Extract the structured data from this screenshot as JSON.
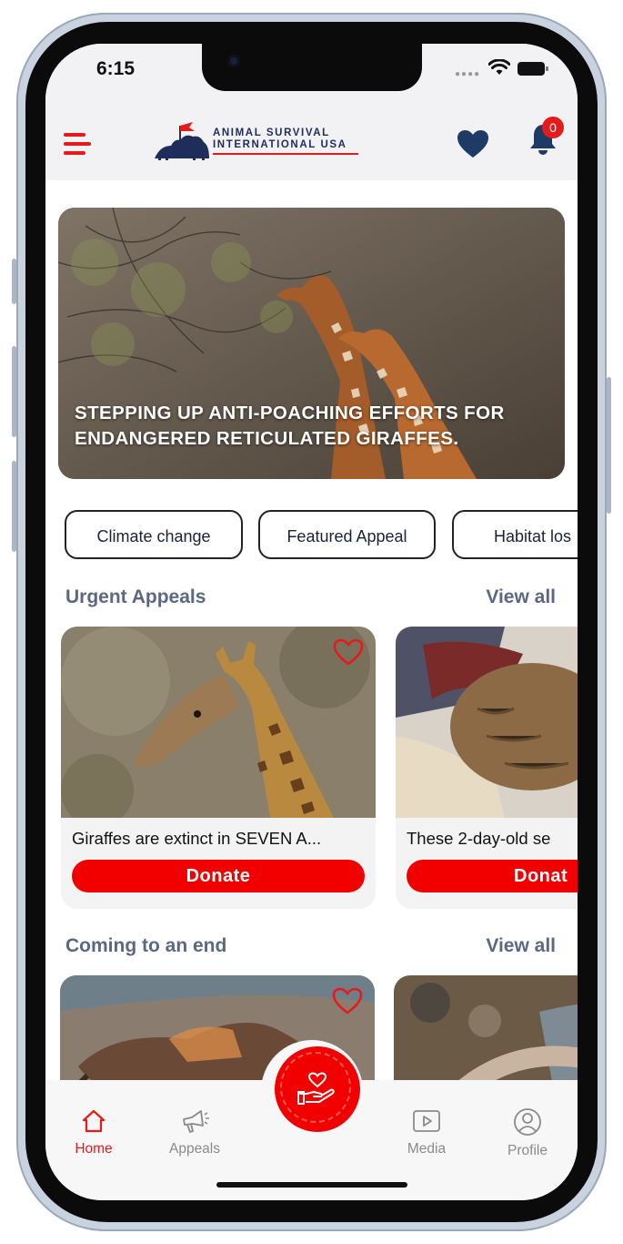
{
  "status_bar": {
    "time": "6:15"
  },
  "header": {
    "logo_line1": "ANIMAL SURVIVAL",
    "logo_line2": "INTERNATIONAL USA",
    "notification_count": "0"
  },
  "hero": {
    "caption": "STEPPING UP ANTI-POACHING EFFORTS FOR ENDANGERED RETICULATED GIRAFFES."
  },
  "categories": [
    "Climate change",
    "Featured Appeal",
    "Habitat los"
  ],
  "urgent_appeals": {
    "title": "Urgent Appeals",
    "view_all": "View all",
    "cards": [
      {
        "title": "Giraffes are extinct in SEVEN A...",
        "button": "Donate"
      },
      {
        "title": "These 2-day-old se",
        "button": "Donat"
      }
    ]
  },
  "coming_to_end": {
    "title": "Coming to an end",
    "view_all": "View all"
  },
  "tabbar": {
    "tabs": [
      {
        "label": "Home",
        "icon": "home-icon",
        "active": true
      },
      {
        "label": "Appeals",
        "icon": "megaphone-icon",
        "active": false
      },
      {
        "label": "Media",
        "icon": "play-icon",
        "active": false
      },
      {
        "label": "Profile",
        "icon": "profile-icon",
        "active": false
      }
    ],
    "center_action_icon": "donate-hand-heart-icon"
  },
  "colors": {
    "brand_red": "#e41b1b",
    "button_red": "#f20000",
    "section_title": "#5a6882",
    "logo_navy": "#1e2d5a"
  }
}
